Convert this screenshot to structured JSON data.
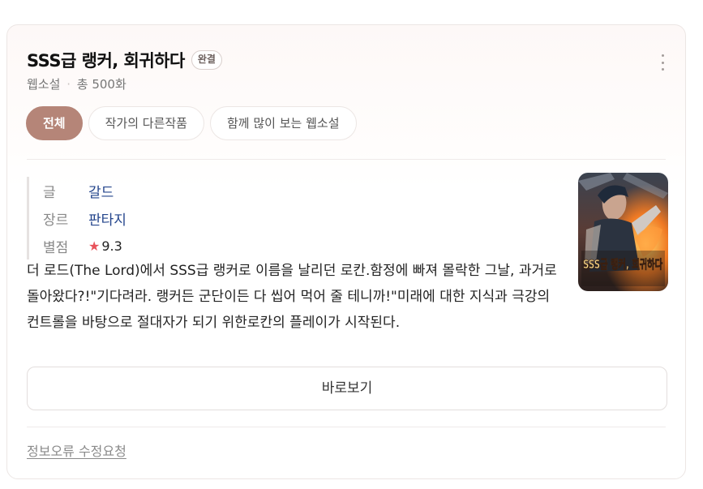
{
  "header": {
    "title": "SSS급 랭커, 회귀하다",
    "badge": "완결",
    "more_icon": "more-vertical-icon"
  },
  "subtitle": {
    "category": "웹소설",
    "separator": "·",
    "episodes": "총 500화"
  },
  "tabs": [
    {
      "label": "전체",
      "active": true
    },
    {
      "label": "작가의 다른작품",
      "active": false
    },
    {
      "label": "함께 많이 보는 웹소설",
      "active": false
    }
  ],
  "info": {
    "author_label": "글",
    "author_value": "갈드",
    "genre_label": "장르",
    "genre_value": "판타지",
    "rating_label": "별점",
    "rating_icon": "star-icon",
    "rating_value": "9.3"
  },
  "cover": {
    "title_text": "SSS급 랭커, 회귀하다"
  },
  "description": "더 로드(The Lord)에서 SSS급 랭커로 이름을 날리던 로칸.함정에 빠져 몰락한 그날, 과거로 돌아왔다?!\"기다려라. 랭커든 군단이든 다 씹어 먹어 줄 테니까!\"미래에 대한 지식과 극강의 컨트롤을 바탕으로 절대자가 되기 위한로칸의 플레이가 시작된다.",
  "actions": {
    "view_label": "바로보기",
    "report_label": "정보오류 수정요청"
  },
  "colors": {
    "accent": "#b58578",
    "link": "#24458c",
    "star": "#e8535b"
  }
}
